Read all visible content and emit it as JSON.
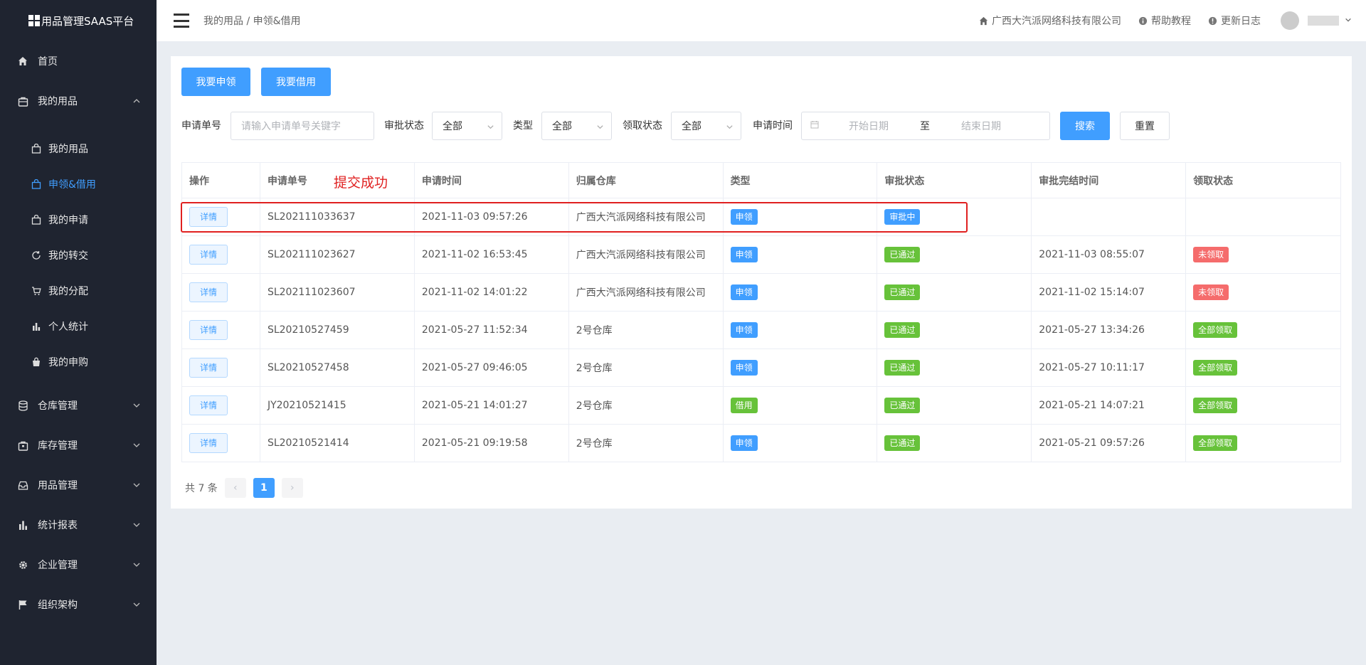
{
  "app": {
    "title": "用品管理SAAS平台"
  },
  "sidebar": {
    "items": [
      {
        "label": "首页",
        "icon": "home-icon"
      },
      {
        "label": "我的用品",
        "icon": "bag-icon",
        "expanded": true,
        "children": [
          {
            "label": "我的用品",
            "icon": "bag-icon"
          },
          {
            "label": "申领&借用",
            "icon": "bag-icon",
            "active": true
          },
          {
            "label": "我的申请",
            "icon": "bag-icon"
          },
          {
            "label": "我的转交",
            "icon": "refresh-icon"
          },
          {
            "label": "我的分配",
            "icon": "cart-icon"
          },
          {
            "label": "个人统计",
            "icon": "bar-chart-icon"
          },
          {
            "label": "我的申购",
            "icon": "shopping-bag-icon"
          }
        ]
      },
      {
        "label": "仓库管理",
        "icon": "database-icon"
      },
      {
        "label": "库存管理",
        "icon": "box-icon"
      },
      {
        "label": "用品管理",
        "icon": "inbox-icon"
      },
      {
        "label": "统计报表",
        "icon": "bar-chart-icon"
      },
      {
        "label": "企业管理",
        "icon": "gear-icon"
      },
      {
        "label": "组织架构",
        "icon": "flag-icon"
      }
    ]
  },
  "header": {
    "breadcrumb": "我的用品 / 申领&借用",
    "company": "广西大汽派网络科技有限公司",
    "help": "帮助教程",
    "changelog": "更新日志"
  },
  "actions": {
    "apply_label": "我要申领",
    "borrow_label": "我要借用"
  },
  "filters": {
    "order_no_label": "申请单号",
    "order_no_placeholder": "请输入申请单号关键字",
    "approval_label": "审批状态",
    "approval_value": "全部",
    "type_label": "类型",
    "type_value": "全部",
    "receive_label": "领取状态",
    "receive_value": "全部",
    "date_label": "申请时间",
    "start_placeholder": "开始日期",
    "date_sep": "至",
    "end_placeholder": "结束日期",
    "search_label": "搜索",
    "reset_label": "重置"
  },
  "table": {
    "headers": [
      "操作",
      "申请单号",
      "申请时间",
      "归属仓库",
      "类型",
      "审批状态",
      "审批完结时间",
      "领取状态"
    ],
    "detail_label": "详情",
    "rows": [
      {
        "order_no": "SL202111033637",
        "time": "2021-11-03 09:57:26",
        "warehouse": "广西大汽派网络科技有限公司",
        "type": "申领",
        "type_color": "blue",
        "approval": "审批中",
        "approval_color": "blue",
        "finish_time": "",
        "receive": "",
        "receive_color": ""
      },
      {
        "order_no": "SL202111023627",
        "time": "2021-11-02 16:53:45",
        "warehouse": "广西大汽派网络科技有限公司",
        "type": "申领",
        "type_color": "blue",
        "approval": "已通过",
        "approval_color": "green",
        "finish_time": "2021-11-03 08:55:07",
        "receive": "未领取",
        "receive_color": "red"
      },
      {
        "order_no": "SL202111023607",
        "time": "2021-11-02 14:01:22",
        "warehouse": "广西大汽派网络科技有限公司",
        "type": "申领",
        "type_color": "blue",
        "approval": "已通过",
        "approval_color": "green",
        "finish_time": "2021-11-02 15:14:07",
        "receive": "未领取",
        "receive_color": "red"
      },
      {
        "order_no": "SL20210527459",
        "time": "2021-05-27 11:52:34",
        "warehouse": "2号仓库",
        "type": "申领",
        "type_color": "blue",
        "approval": "已通过",
        "approval_color": "green",
        "finish_time": "2021-05-27 13:34:26",
        "receive": "全部领取",
        "receive_color": "green"
      },
      {
        "order_no": "SL20210527458",
        "time": "2021-05-27 09:46:05",
        "warehouse": "2号仓库",
        "type": "申领",
        "type_color": "blue",
        "approval": "已通过",
        "approval_color": "green",
        "finish_time": "2021-05-27 10:11:17",
        "receive": "全部领取",
        "receive_color": "green"
      },
      {
        "order_no": "JY20210521415",
        "time": "2021-05-21 14:01:27",
        "warehouse": "2号仓库",
        "type": "借用",
        "type_color": "green",
        "approval": "已通过",
        "approval_color": "green",
        "finish_time": "2021-05-21 14:07:21",
        "receive": "全部领取",
        "receive_color": "green"
      },
      {
        "order_no": "SL20210521414",
        "time": "2021-05-21 09:19:58",
        "warehouse": "2号仓库",
        "type": "申领",
        "type_color": "blue",
        "approval": "已通过",
        "approval_color": "green",
        "finish_time": "2021-05-21 09:57:26",
        "receive": "全部领取",
        "receive_color": "green"
      }
    ]
  },
  "annotation": {
    "text": "提交成功"
  },
  "pagination": {
    "total_label": "共 7 条",
    "current_page": "1",
    "prev": "‹",
    "next": "›"
  },
  "colors": {
    "primary": "#409eff",
    "success": "#67c23a",
    "danger": "#f56c6c",
    "sidebar_bg": "#1f2430",
    "annotation": "#e02020"
  }
}
